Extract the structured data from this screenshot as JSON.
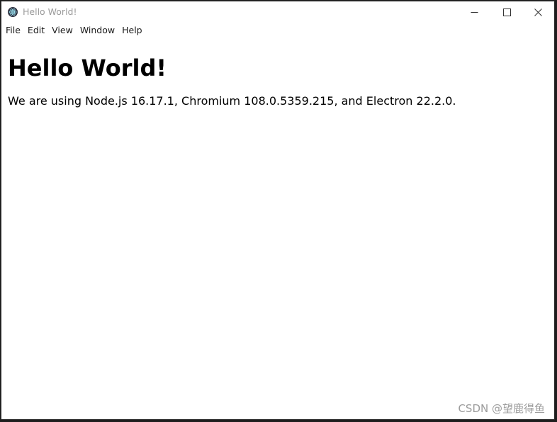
{
  "window": {
    "title": "Hello World!",
    "icon": "electron-icon"
  },
  "caption_buttons": {
    "minimize": "minimize-icon",
    "maximize": "maximize-icon",
    "close": "close-icon"
  },
  "menu": {
    "items": [
      {
        "label": "File"
      },
      {
        "label": "Edit"
      },
      {
        "label": "View"
      },
      {
        "label": "Window"
      },
      {
        "label": "Help"
      }
    ]
  },
  "main": {
    "heading": "Hello World!",
    "paragraph": "We are using Node.js 16.17.1, Chromium 108.0.5359.215, and Electron 22.2.0."
  },
  "watermark": "CSDN @望鹿得鱼",
  "colors": {
    "titlebar_background": "#ffffff",
    "window_border": "#2b2b2b",
    "title_text": "#9a9a9a",
    "watermark_text": "#9c9c9c"
  }
}
